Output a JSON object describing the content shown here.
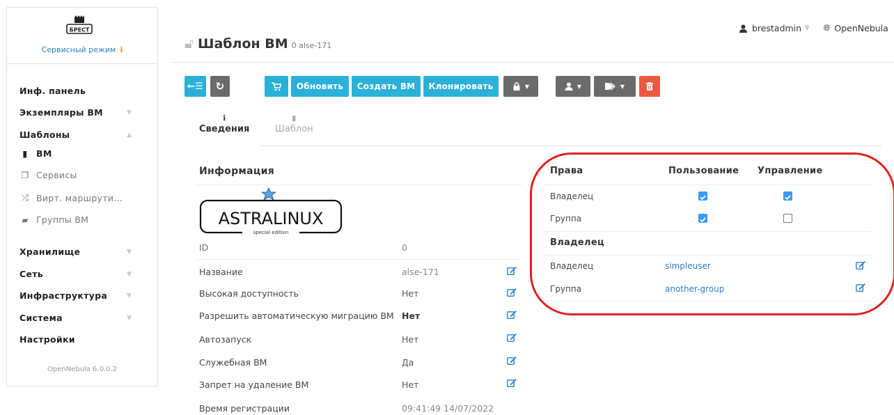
{
  "sidebar": {
    "logo_text": "БРЕСТ",
    "service_mode": "Сервисный режим",
    "warn": "ℹ",
    "items": [
      {
        "label": "Инф. панель"
      },
      {
        "label": "Экземпляры ВМ"
      },
      {
        "label": "Шаблоны"
      },
      {
        "label": "ВМ"
      },
      {
        "label": "Сервисы"
      },
      {
        "label": "Вирт. маршрути..."
      },
      {
        "label": "Группы ВМ"
      },
      {
        "label": "Хранилище"
      },
      {
        "label": "Сеть"
      },
      {
        "label": "Инфраструктура"
      },
      {
        "label": "Система"
      },
      {
        "label": "Настройки"
      }
    ],
    "version": "OpenNebula 6.0.0.2"
  },
  "header": {
    "title": "Шаблон ВМ",
    "subtitle": "0 alse-171",
    "user": "brestadmin",
    "zone": "OpenNebula"
  },
  "toolbar": {
    "back_icon": "←☰",
    "refresh_icon": "↻",
    "cart_icon": "cart-icon",
    "update": "Обновить",
    "create_vm": "Создать ВМ",
    "clone": "Клонировать"
  },
  "tabs": [
    {
      "label": "Сведения",
      "icon": "ℹ"
    },
    {
      "label": "Шаблон",
      "icon": "▮"
    }
  ],
  "info": {
    "heading": "Информация",
    "logo_text": "ASTRALINUX",
    "logo_sub": "special edition",
    "rows": [
      {
        "label": "ID",
        "value": "0"
      },
      {
        "label": "Название",
        "value": "alse-171"
      },
      {
        "label": "Высокая доступность",
        "value": "Нет"
      },
      {
        "label": "Разрешить автоматическую миграцию ВМ",
        "value": "Нет"
      },
      {
        "label": "Автозапуск",
        "value": "Нет"
      },
      {
        "label": "Служебная ВМ",
        "value": "Да"
      },
      {
        "label": "Запрет на удаление ВМ",
        "value": "Нет"
      },
      {
        "label": "Время регистрации",
        "value": "09:41:49 14/07/2022"
      }
    ]
  },
  "permissions": {
    "heading": "Права",
    "col_use": "Пользование",
    "col_manage": "Управление",
    "rows": [
      {
        "label": "Владелец",
        "use": true,
        "manage": true
      },
      {
        "label": "Группа",
        "use": true,
        "manage": false
      }
    ]
  },
  "ownership": {
    "heading": "Владелец",
    "rows": [
      {
        "label": "Владелец",
        "value": "simpleuser"
      },
      {
        "label": "Группа",
        "value": "another-group"
      }
    ]
  },
  "colors": {
    "accent": "#2bb0d8",
    "gray_button": "#6b6b6b",
    "danger": "#ec5840",
    "link": "#2a80c5",
    "checkbox": "#3b99fc",
    "annotation": "#e02020"
  }
}
